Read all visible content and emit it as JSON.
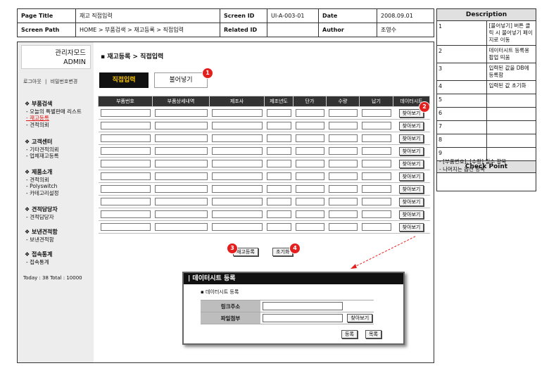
{
  "header": {
    "page_title_label": "Page Title",
    "page_title_value": "재고 직접입력",
    "screen_id_label": "Screen ID",
    "screen_id_value": "UI-A-003-01",
    "date_label": "Date",
    "date_value": "2008.09.01",
    "screen_path_label": "Screen Path",
    "screen_path_value": "HOME > 부품검색 > 재고등록 > 직접입력",
    "related_id_label": "Related ID",
    "related_id_value": "",
    "author_label": "Author",
    "author_value": "조영수"
  },
  "description": {
    "title": "Description",
    "items": [
      {
        "num": "1",
        "text": "[불어넣기] 버튼 클릭 시 불어넣기 페이지로 이동"
      },
      {
        "num": "2",
        "text": "데이터시트 등록용 팝업 띄움"
      },
      {
        "num": "3",
        "text": "입력된 값을 DB에 등록함"
      },
      {
        "num": "4",
        "text": "입력된 값 초기화"
      },
      {
        "num": "5",
        "text": ""
      },
      {
        "num": "6",
        "text": ""
      },
      {
        "num": "7",
        "text": ""
      },
      {
        "num": "8",
        "text": ""
      },
      {
        "num": "9",
        "text": ""
      }
    ],
    "checkpoint_title": "Check Point",
    "checkpoints": [
      "- [부품번호], [수량] 필수 항목",
      "- 나머지는 옵션 항목"
    ]
  },
  "sidebar": {
    "admin_line1": "관리자모드",
    "admin_line2": "ADMIN",
    "logout": "로그아웃",
    "separator": "|",
    "change_pw": "비밀번호변경",
    "groups": [
      {
        "title": "❖ 부품검색",
        "items": [
          "- 오늘의 특별판매 리스트",
          "- 재고등록",
          "- 견적의뢰"
        ]
      },
      {
        "title": "❖ 고객센터",
        "items": [
          "- 기타견적의뢰",
          "- 업체재고등록"
        ]
      },
      {
        "title": "❖ 제품소개",
        "items": [
          "- 견적의뢰",
          "- Polyswitch",
          "- 카테고리설정"
        ]
      },
      {
        "title": "❖ 견적담당자",
        "items": [
          "- 견적담당자"
        ]
      },
      {
        "title": "❖ 보낸견적함",
        "items": [
          "- 보낸견적함"
        ]
      },
      {
        "title": "❖ 접속통계",
        "items": [
          "- 접속통계"
        ]
      }
    ],
    "stats": "Today : 38   Total : 10000"
  },
  "main": {
    "breadcrumb": "▪ 재고등록 > 직접입력",
    "tab_direct": "직접입력",
    "tab_import": "불어넣기",
    "columns": [
      "부품번호",
      "부품상세내역",
      "제조사",
      "제조년도",
      "단가",
      "수량",
      "납기",
      "데이터시트"
    ],
    "find_label": "찾아보기",
    "register_button": "재고등록",
    "reset_button": "초기화"
  },
  "popup": {
    "title": "| 데이터시트 등록",
    "subtitle": "▪ 데이터시트 등록",
    "link_label": "링크주소",
    "file_label": "파일첨부",
    "find_label": "찾아보기",
    "register_button": "등록",
    "list_button": "목록"
  },
  "badges": [
    "1",
    "2",
    "3",
    "4"
  ],
  "colors": {
    "accent": "#e4201e",
    "tab_text": "#f4c000",
    "active_menu": "#e01010"
  }
}
